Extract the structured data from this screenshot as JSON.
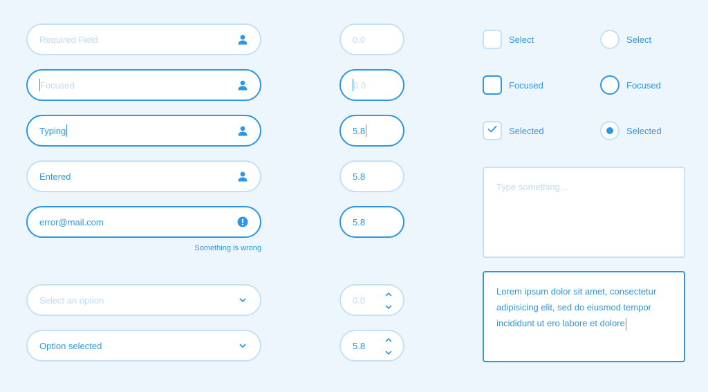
{
  "colors": {
    "background": "#eef6fd",
    "accent": "#2b97e6",
    "border_light": "#c4e1f7",
    "placeholder": "#bfdcf3"
  },
  "text_fields": {
    "required": {
      "placeholder": "Required Field",
      "icon": "user-icon"
    },
    "focused": {
      "placeholder": "Focused",
      "icon": "user-icon"
    },
    "typing": {
      "value": "Typing",
      "icon": "user-icon"
    },
    "entered": {
      "value": "Entered",
      "icon": "user-icon"
    },
    "error": {
      "value": "error@mail.com",
      "icon": "alert-icon",
      "message": "Something is wrong"
    }
  },
  "number_fields": {
    "default": {
      "placeholder": "0.0"
    },
    "focused": {
      "placeholder": "0.0"
    },
    "typing": {
      "value": "5.8"
    },
    "entered": {
      "value": "5.8"
    },
    "active": {
      "value": "5.8"
    }
  },
  "selects": {
    "empty": {
      "placeholder": "Select an option",
      "icon": "chevron-down-icon"
    },
    "selected": {
      "value": "Option selected",
      "icon": "chevron-down-icon"
    }
  },
  "steppers": {
    "empty": {
      "placeholder": "0.0"
    },
    "filled": {
      "value": "5.8"
    }
  },
  "checkboxes": {
    "default": {
      "label": "Select"
    },
    "focused": {
      "label": "Focused"
    },
    "selected": {
      "label": "Selected"
    }
  },
  "radios": {
    "default": {
      "label": "Select"
    },
    "focused": {
      "label": "Focused"
    },
    "selected": {
      "label": "Selected"
    }
  },
  "textareas": {
    "empty": {
      "placeholder": "Type something…"
    },
    "filled": {
      "value": "Lorem ipsum dolor sit amet, consectetur adipisicing elit, sed do eiusmod tempor incididunt ut ero labore et dolore"
    }
  }
}
